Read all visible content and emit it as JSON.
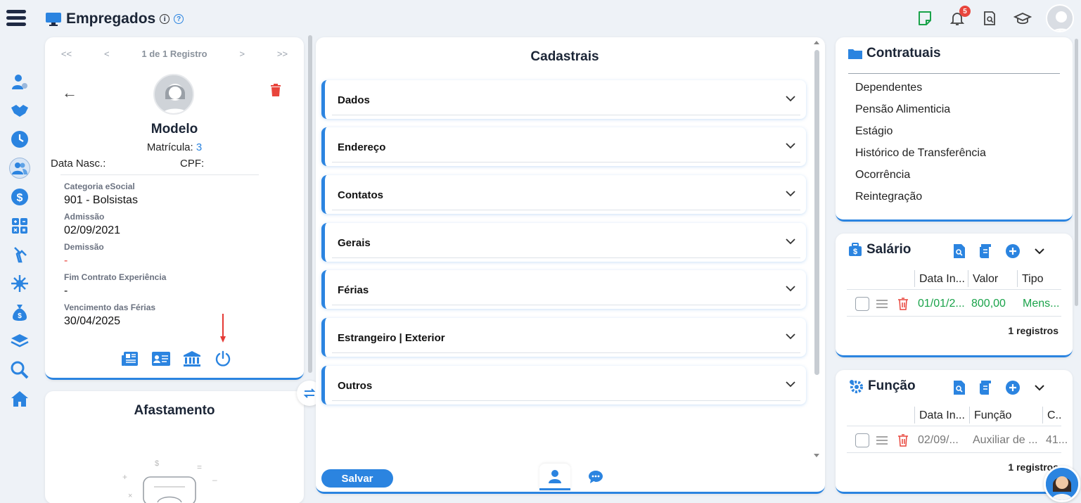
{
  "header": {
    "title": "Empregados",
    "notification_count": "5"
  },
  "profile": {
    "pager_text": "1 de 1 Registro",
    "name": "Modelo",
    "matricula_label": "Matrícula:",
    "matricula_value": "3",
    "data_nasc_label": "Data Nasc.:",
    "cpf_label": "CPF:",
    "fields": [
      {
        "label": "Categoria eSocial",
        "value": "901 - Bolsistas"
      },
      {
        "label": "Admissão",
        "value": "02/09/2021"
      },
      {
        "label": "Demissão",
        "value": "-"
      },
      {
        "label": "Fim Contrato Experiência",
        "value": "-"
      },
      {
        "label": "Vencimento das Férias",
        "value": "30/04/2025"
      }
    ]
  },
  "afastamento": {
    "title": "Afastamento"
  },
  "cadastrais": {
    "title": "Cadastrais",
    "sections": [
      "Dados",
      "Endereço",
      "Contatos",
      "Gerais",
      "Férias",
      "Estrangeiro | Exterior",
      "Outros"
    ],
    "save_label": "Salvar"
  },
  "contratuais": {
    "title": "Contratuais",
    "links": [
      "Dependentes",
      "Pensão Alimenticia",
      "Estágio",
      "Histórico de Transferência",
      "Ocorrência",
      "Reintegração"
    ]
  },
  "salario": {
    "title": "Salário",
    "columns": [
      "Data In...",
      "Valor",
      "Tipo"
    ],
    "row": {
      "data": "01/01/2...",
      "valor": "800,00",
      "tipo": "Mens..."
    },
    "count": "1 registros"
  },
  "funcao": {
    "title": "Função",
    "columns": [
      "Data In...",
      "Função",
      "C..."
    ],
    "row": {
      "data": "02/09/...",
      "funcao": "Auxiliar de ...",
      "c": "41..."
    },
    "count": "1 registros"
  },
  "colors": {
    "accent": "#2b84e0",
    "danger": "#e8453c",
    "success": "#1aa34a",
    "dark": "#1f2a44"
  }
}
